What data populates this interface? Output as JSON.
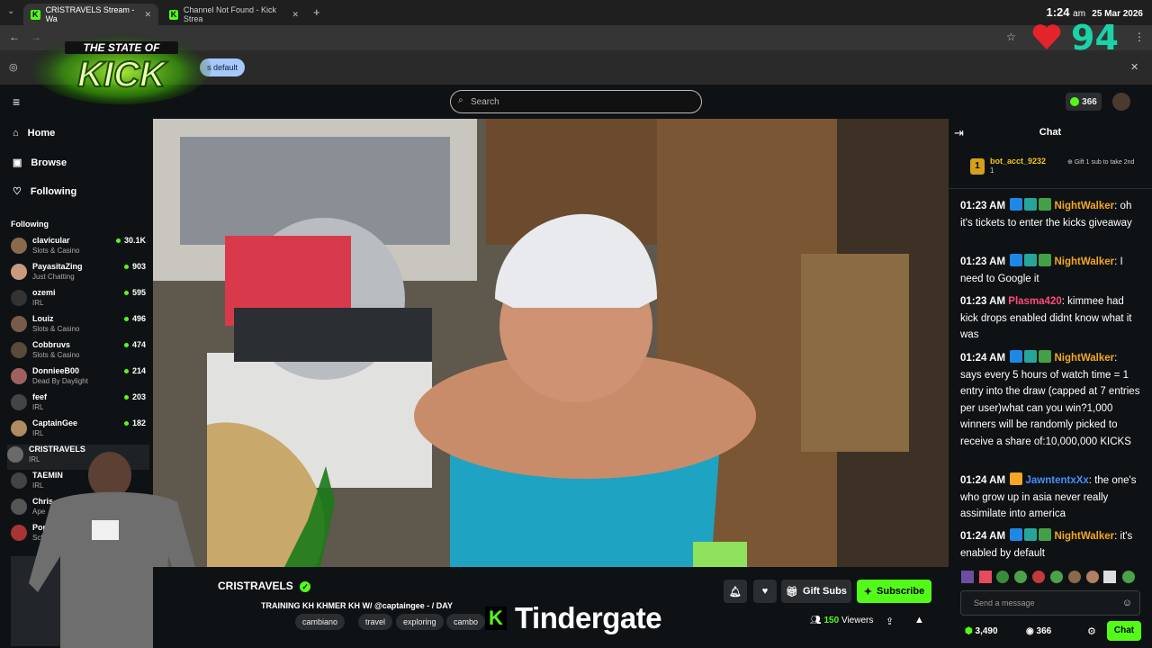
{
  "browser": {
    "tabs": [
      {
        "title": "CRISTRAVELS Stream - Wa"
      },
      {
        "title": "Channel Not Found - Kick Strea"
      }
    ],
    "clock": {
      "time": "1:24",
      "ampm": "am",
      "date": "25 Mar 2026"
    },
    "overlay_number": "94",
    "infobar_text": "s default"
  },
  "logo": {
    "line1": "THE STATE OF",
    "line2": "KICK"
  },
  "header": {
    "search_placeholder": "Search",
    "points": "366"
  },
  "sidebar": {
    "nav": [
      {
        "label": "Home",
        "icon": "home-icon"
      },
      {
        "label": "Browse",
        "icon": "browse-icon"
      },
      {
        "label": "Following",
        "icon": "heart-icon"
      }
    ],
    "following_title": "Following",
    "following": [
      {
        "name": "clavicular",
        "category": "Slots & Casino",
        "viewers": "30.1K"
      },
      {
        "name": "PayasitaZing",
        "category": "Just Chatting",
        "viewers": "903"
      },
      {
        "name": "ozemi",
        "category": "IRL",
        "viewers": "595"
      },
      {
        "name": "Louiz",
        "category": "Slots & Casino",
        "viewers": "496"
      },
      {
        "name": "Cobbruvs",
        "category": "Slots & Casino",
        "viewers": "474"
      },
      {
        "name": "DonnieeB00",
        "category": "Dead By Daylight",
        "viewers": "214"
      },
      {
        "name": "feef",
        "category": "IRL",
        "viewers": "203"
      },
      {
        "name": "CaptainGee",
        "category": "IRL",
        "viewers": "182"
      },
      {
        "name": "CRISTRAVELS",
        "category": "IRL",
        "viewers": ""
      },
      {
        "name": "TAEMIN",
        "category": "IRL",
        "viewers": ""
      },
      {
        "name": "Chris",
        "category": "Ape",
        "viewers": ""
      },
      {
        "name": "Pop",
        "category": "Sch",
        "viewers": ""
      }
    ]
  },
  "stream": {
    "channel": "CRISTRAVELS",
    "title": "TRAINING KH KHMER KH W/ @captaingee - / DAY",
    "tags": [
      "cambiano",
      "travel",
      "exploring",
      "cambo"
    ],
    "viewers": "150",
    "viewers_label": "Viewers",
    "gift_subs": "Gift Subs",
    "subscribe": "Subscribe"
  },
  "chat": {
    "title": "Chat",
    "pinned": {
      "rank": "1",
      "user": "bot_acct_9232",
      "count": "1",
      "gift_text": "Gift 1 sub to take 2nd"
    },
    "messages": [
      {
        "time": "01:23 AM",
        "user": "NightWalker",
        "color": "#f5a623",
        "text": "oh it's tickets to enter the kicks giveaway"
      },
      {
        "time": "01:23 AM",
        "user": "NightWalker",
        "color": "#f5a623",
        "text": "I need to Google it"
      },
      {
        "time": "01:23 AM",
        "user": "Plasma420",
        "color": "#ff4b7a",
        "text": "kimmee had kick drops enabled didnt know what it was"
      },
      {
        "time": "01:24 AM",
        "user": "NightWalker",
        "color": "#f5a623",
        "text": "says every 5 hours of watch time = 1 entry into the draw (capped at 7 entries per user)what can you win?1,000 winners will be randomly picked to receive a share of:10,000,000 KICKS"
      },
      {
        "time": "01:24 AM",
        "user": "JawntentxXx",
        "color": "#4a8cff",
        "text": "the one's who grow up in asia never really assimilate into america"
      },
      {
        "time": "01:24 AM",
        "user": "NightWalker",
        "color": "#f5a623",
        "text": "it's enabled by default"
      }
    ],
    "input_placeholder": "Send a message",
    "balance": "3,490",
    "points": "366",
    "chat_button": "Chat"
  },
  "overlay_text": "Tindergate",
  "colors": {
    "kick_green": "#53fc18",
    "bg": "#0f1214"
  }
}
